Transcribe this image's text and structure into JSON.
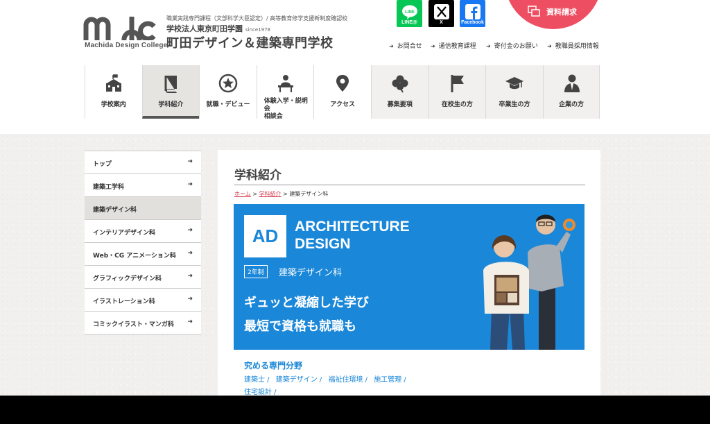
{
  "header": {
    "logo_text": "mdc",
    "logo_sub": "Machida Design College",
    "school_small": "職業実践専門課程（文部科学大臣認定）/ 高等教育修学支援新制度確認校",
    "school_corp": "学校法人東京町田学園",
    "school_since": "since1978",
    "school_name": "町田デザイン＆建築専門学校"
  },
  "sns": {
    "line_label": "LINE@",
    "x_label": "X",
    "facebook_label": "Facebook"
  },
  "request": {
    "label": "資料請求"
  },
  "utility_links": [
    {
      "label": "お問合せ"
    },
    {
      "label": "通信教育課程"
    },
    {
      "label": "寄付金のお願い"
    },
    {
      "label": "教職員採用情報"
    }
  ],
  "gnav": [
    {
      "label": "学校案内",
      "icon": "school-icon"
    },
    {
      "label": "学科紹介",
      "icon": "book-icon"
    },
    {
      "label": "就職・デビュー",
      "icon": "star-icon"
    },
    {
      "label": "体験入学・説明会\n相談会",
      "icon": "desk-icon"
    },
    {
      "label": "アクセス",
      "icon": "map-pin-icon"
    },
    {
      "label": "募集要項",
      "icon": "clover-icon"
    },
    {
      "label": "在校生の方",
      "icon": "flag-icon"
    },
    {
      "label": "卒業生の方",
      "icon": "graduation-cap-icon"
    },
    {
      "label": "企業の方",
      "icon": "businessman-icon"
    }
  ],
  "side_menu": [
    {
      "label": "トップ"
    },
    {
      "label": "建築工学科"
    },
    {
      "label": "建築デザイン科"
    },
    {
      "label": "インテリアデザイン科"
    },
    {
      "label": "Web・CG アニメーション科"
    },
    {
      "label": "グラフィックデザイン科"
    },
    {
      "label": "イラストレーション科"
    },
    {
      "label": "コミックイラスト・マンガ科"
    }
  ],
  "content": {
    "title": "学科紹介",
    "breadcrumb": {
      "home": "ホーム",
      "parent": "学科紹介",
      "current": "建築デザイン科",
      "sep": ">"
    },
    "hero": {
      "badge": "AD",
      "title_line1": "ARCHITECTURE",
      "title_line2": "DESIGN",
      "years": "2年制",
      "dept": "建築デザイン科",
      "catch1": "ギュッと凝縮した学び",
      "catch2": "最短で資格も就職も"
    },
    "fields_heading": "究める専門分野",
    "fields": [
      "建築士 /",
      "建築デザイン /",
      "福祉住環境 /",
      "施工管理 /",
      "住宅設計 /"
    ]
  },
  "colors": {
    "accent_red": "#ee4e62",
    "hero_blue": "#1a87d8",
    "line_green": "#06c755",
    "facebook_blue": "#1877f2"
  }
}
